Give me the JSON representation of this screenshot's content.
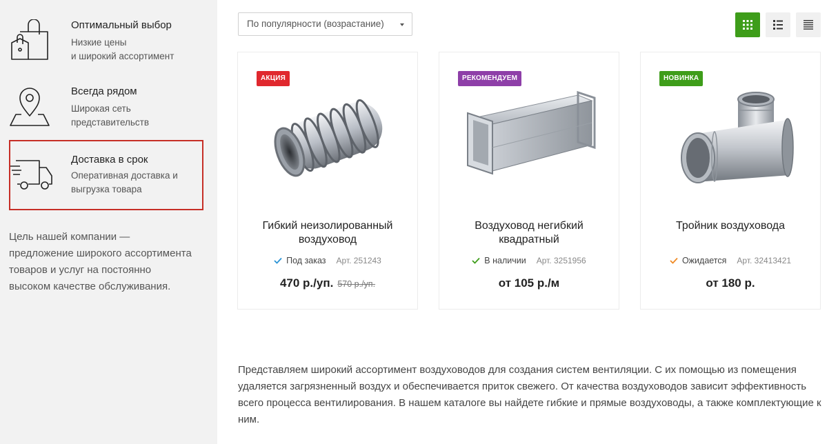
{
  "sidebar": {
    "features": [
      {
        "title": "Оптимальный выбор",
        "line1": "Низкие цены",
        "line2": "и широкий ассортимент",
        "icon": "shopping-bags-icon"
      },
      {
        "title": "Всегда рядом",
        "line1": "Широкая сеть",
        "line2": "представительств",
        "icon": "map-pin-icon"
      },
      {
        "title": "Доставка в срок",
        "line1": "Оперативная доставка и",
        "line2": "выгрузка товара",
        "icon": "delivery-truck-icon"
      }
    ],
    "company_text": "Цель нашей компании — предложение широкого ассортимента товаров и услуг на постоянно высоком качестве обслуживания."
  },
  "toolbar": {
    "sort_value": "По популярности (возрастание)",
    "views": [
      "grid-view-icon",
      "list-view-icon",
      "table-view-icon"
    ],
    "active_view": "grid",
    "accent_color": "#3e9d1a"
  },
  "products": [
    {
      "badge": "АКЦИЯ",
      "badge_color": "#e0282e",
      "name_line1": "Гибкий неизолированный",
      "name_line2": "воздуховод",
      "status": "Под заказ",
      "status_color": "#2a93d5",
      "article": "Арт. 251243",
      "price": "470 р./уп.",
      "old_price": "570 р./уп."
    },
    {
      "badge": "РЕКОМЕНДУЕМ",
      "badge_color": "#8e3fa8",
      "name_line1": "Воздуховод негибкий",
      "name_line2": "квадратный",
      "status": "В наличии",
      "status_color": "#3e9d1a",
      "article": "Арт. 3251956",
      "price": "от 105 р./м",
      "old_price": ""
    },
    {
      "badge": "НОВИНКА",
      "badge_color": "#3e9d1a",
      "name_line1": "Тройник воздуховода",
      "name_line2": "",
      "status": "Ожидается",
      "status_color": "#f08a24",
      "article": "Арт. 32413421",
      "price": "от 180 р.",
      "old_price": ""
    }
  ],
  "description": "Представляем широкий ассортимент воздуховодов для создания систем вентиляции. С их помощью из помещения удаляется загрязненный воздух и обеспечивается приток свежего. От качества воздуховодов зависит эффективность всего процесса вентилирования. В нашем каталоге вы найдете гибкие и прямые воздуховоды, а также комплектующие к ним."
}
